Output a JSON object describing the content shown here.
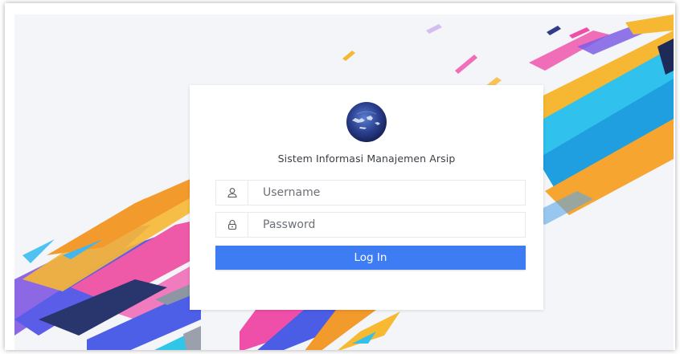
{
  "login": {
    "app_title": "Sistem Informasi Manajemen Arsip",
    "username_placeholder": "Username",
    "password_placeholder": "Password",
    "submit_label": "Log In"
  },
  "icons": {
    "logo": "indonesia-globe-logo",
    "username": "user-icon",
    "password": "lock-icon"
  },
  "colors": {
    "primary": "#3d7cf3",
    "background": "#f3f5f8",
    "logo_red": "#e01f2d",
    "logo_globe": "#2b3f8f"
  }
}
